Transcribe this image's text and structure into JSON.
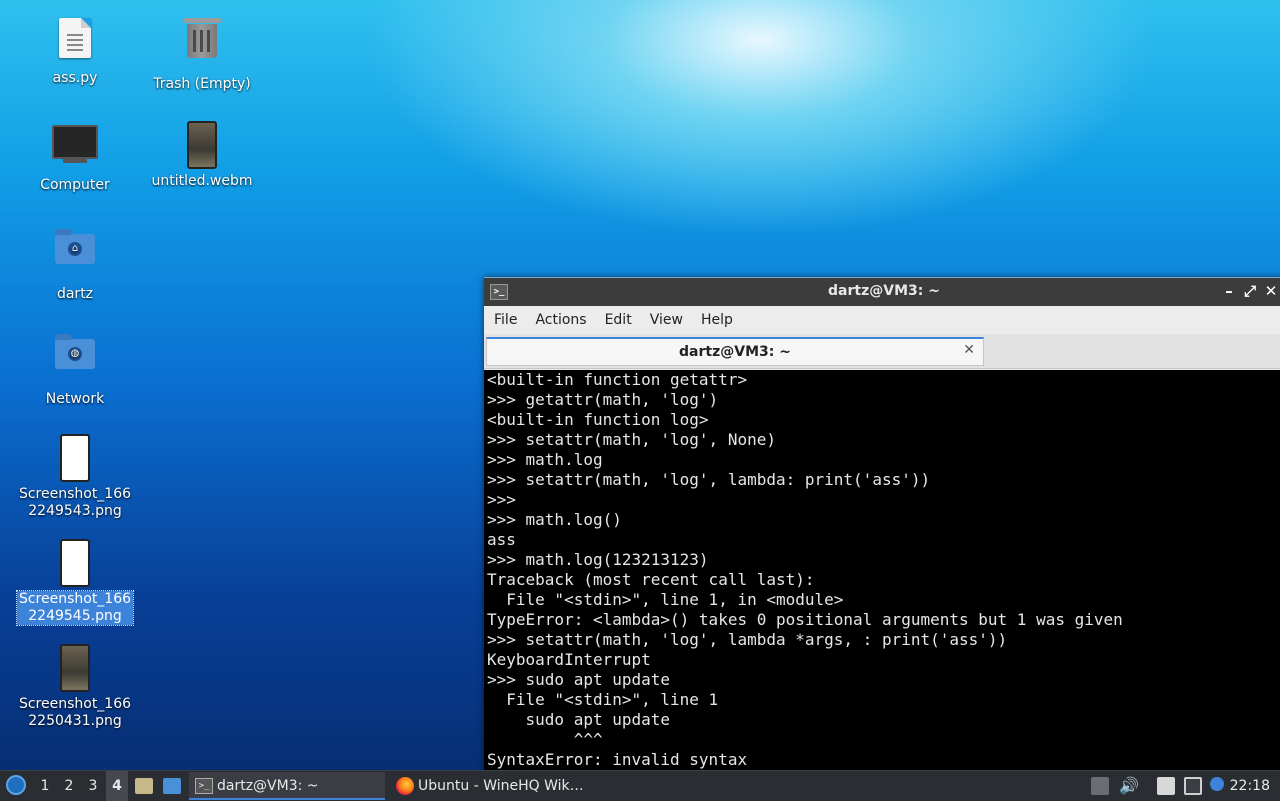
{
  "desktop": {
    "icons": [
      {
        "label": "ass.py",
        "icon": "python-file-icon"
      },
      {
        "label": "Trash (Empty)",
        "icon": "trash-icon"
      },
      {
        "label": "Computer",
        "icon": "computer-icon"
      },
      {
        "label": "untitled.webm",
        "icon": "video-file-icon"
      },
      {
        "label": "dartz",
        "icon": "home-folder-icon"
      },
      {
        "label": "Network",
        "icon": "network-folder-icon"
      },
      {
        "label": "Screenshot_166\n2249543.png",
        "icon": "image-file-icon"
      },
      {
        "label": "Screenshot_166\n2249545.png",
        "icon": "image-file-icon",
        "selected": true
      },
      {
        "label": "Screenshot_166\n2250431.png",
        "icon": "image-file-icon"
      }
    ]
  },
  "terminal": {
    "window_title": "dartz@VM3: ~",
    "menu": [
      "File",
      "Actions",
      "Edit",
      "View",
      "Help"
    ],
    "tab_title": "dartz@VM3: ~",
    "lines": [
      "<built-in function getattr>",
      ">>> getattr(math, 'log')",
      "<built-in function log>",
      ">>> setattr(math, 'log', None)",
      ">>> math.log",
      ">>> setattr(math, 'log', lambda: print('ass'))",
      ">>> ",
      ">>> math.log()",
      "ass",
      ">>> math.log(123213123)",
      "Traceback (most recent call last):",
      "  File \"<stdin>\", line 1, in <module>",
      "TypeError: <lambda>() takes 0 positional arguments but 1 was given",
      ">>> setattr(math, 'log', lambda *args, : print('ass'))",
      "KeyboardInterrupt",
      ">>> sudo apt update",
      "  File \"<stdin>\", line 1",
      "    sudo apt update",
      "         ^^^",
      "SyntaxError: invalid syntax"
    ]
  },
  "taskbar": {
    "workspaces": [
      "1",
      "2",
      "3",
      "4"
    ],
    "active_workspace": "4",
    "tasks": [
      {
        "label": "dartz@VM3: ~",
        "icon": "terminal-icon",
        "active": true
      },
      {
        "label": "Ubuntu - WineHQ Wik…",
        "icon": "firefox-icon",
        "active": false
      }
    ],
    "clock": "22:18"
  },
  "colors": {
    "accent": "#3d83d9",
    "taskbar_bg": "#2a2e33",
    "terminal_bg": "#000000"
  }
}
